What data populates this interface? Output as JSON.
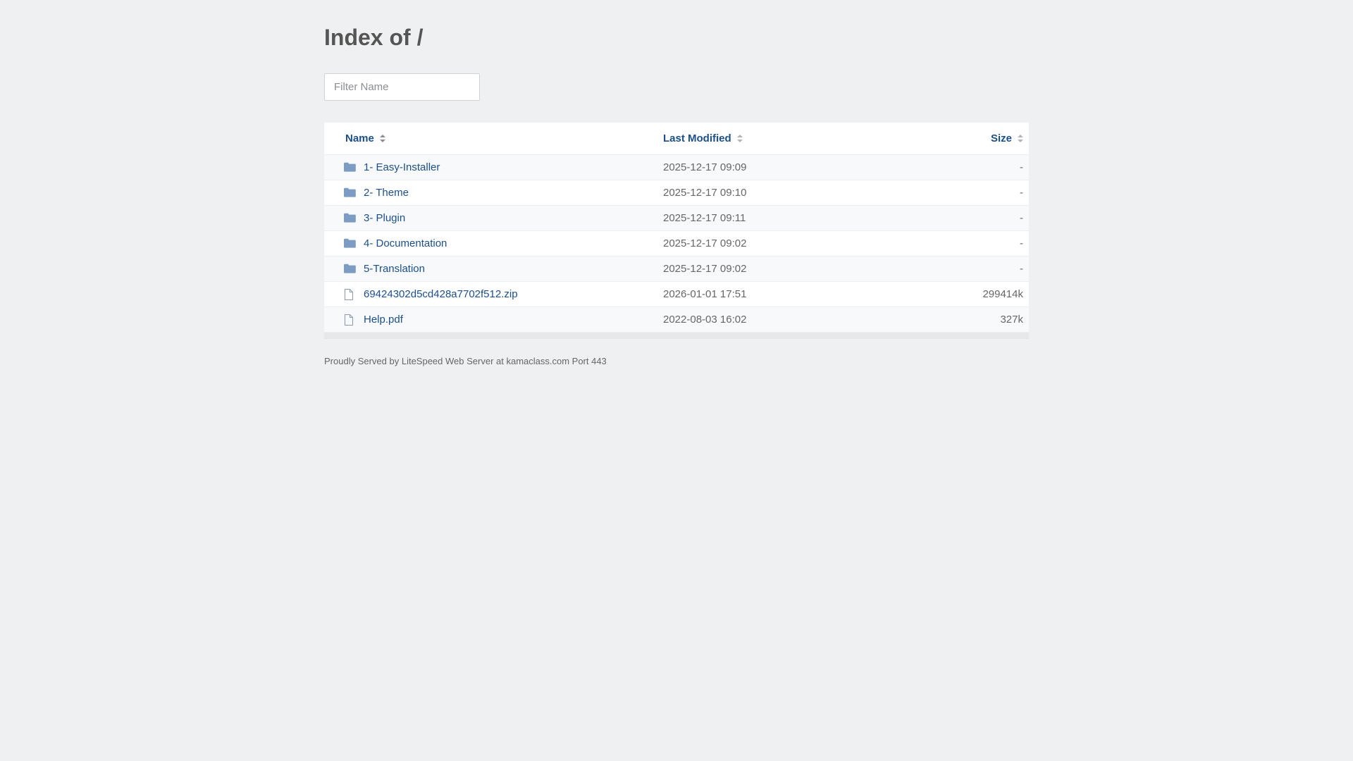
{
  "page": {
    "title": "Index of /",
    "filter_placeholder": "Filter Name"
  },
  "columns": {
    "name": "Name",
    "last_modified": "Last Modified",
    "size": "Size",
    "sort_icon": "sort-arrows-icon"
  },
  "rows": [
    {
      "type": "folder",
      "icon": "folder-icon",
      "name": "1- Easy-Installer",
      "modified": "2025-12-17 09:09",
      "size": "-"
    },
    {
      "type": "folder",
      "icon": "folder-icon",
      "name": "2- Theme",
      "modified": "2025-12-17 09:10",
      "size": "-"
    },
    {
      "type": "folder",
      "icon": "folder-icon",
      "name": "3- Plugin",
      "modified": "2025-12-17 09:11",
      "size": "-"
    },
    {
      "type": "folder",
      "icon": "folder-icon",
      "name": "4- Documentation",
      "modified": "2025-12-17 09:02",
      "size": "-"
    },
    {
      "type": "folder",
      "icon": "folder-icon",
      "name": "5-Translation",
      "modified": "2025-12-17 09:02",
      "size": "-"
    },
    {
      "type": "file",
      "icon": "file-icon",
      "name": "69424302d5cd428a7702f512.zip",
      "modified": "2026-01-01 17:51",
      "size": "299414k"
    },
    {
      "type": "file",
      "icon": "file-icon",
      "name": "Help.pdf",
      "modified": "2022-08-03 16:02",
      "size": "327k"
    }
  ],
  "footer": "Proudly Served by LiteSpeed Web Server at kamaclass.com Port 443",
  "colors": {
    "background": "#eef0f2",
    "link": "#1a4f8f",
    "folder_icon": "#7d9cc4",
    "file_icon": "#8a9bb0"
  }
}
